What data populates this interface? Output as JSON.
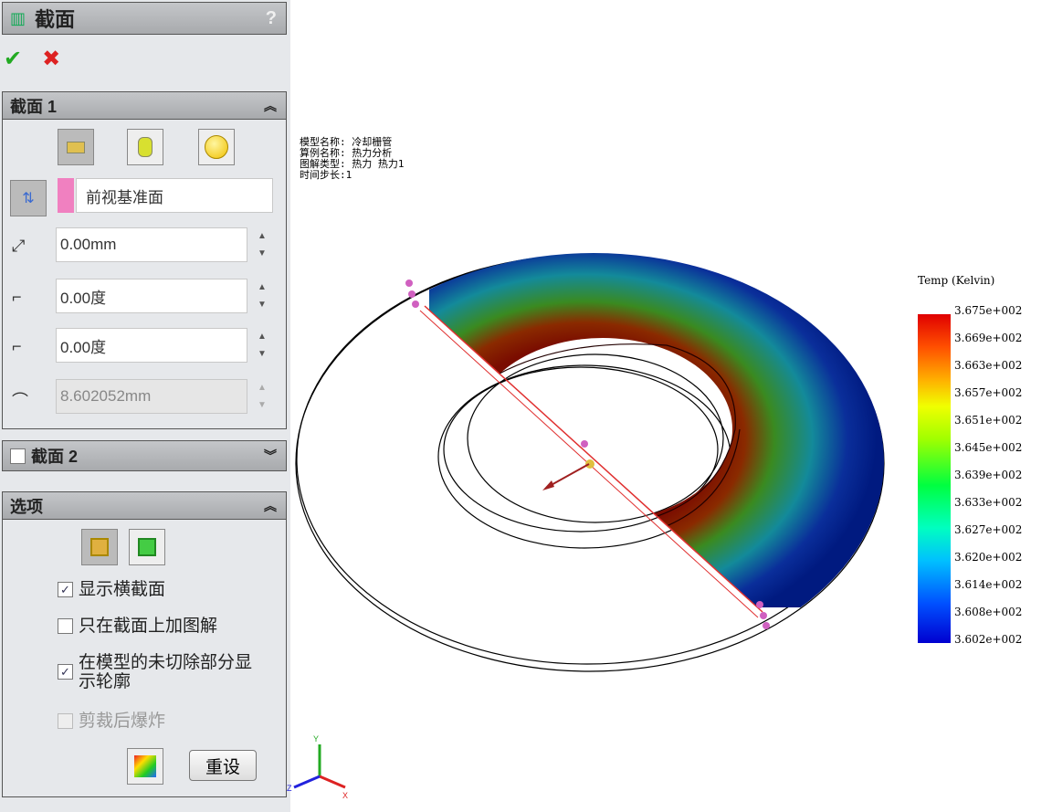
{
  "panel": {
    "title": "截面",
    "help": "?",
    "ok": "✔",
    "cancel": "✖",
    "section1": {
      "title": "截面 1",
      "plane": "前视基准面",
      "offset": "0.00mm",
      "rot_x": "0.00度",
      "rot_y": "0.00度",
      "distance": "8.602052mm"
    },
    "section2": {
      "title": "截面 2"
    },
    "options": {
      "title": "选项",
      "show_cross_section": "显示横截面",
      "plot_on_section_only": "只在截面上加图解",
      "show_outline_line1": "在模型的未切除部分显",
      "show_outline_line2": "示轮廓",
      "explode_after_clip": "剪裁后爆炸",
      "reset": "重设"
    }
  },
  "info": [
    "模型名称: 冷却栅管",
    "算例名称: 热力分析",
    "图解类型: 热力 热力1",
    "时间步长:1"
  ],
  "legend": {
    "title": "Temp (Kelvin)",
    "labels": [
      "3.675e+002",
      "3.669e+002",
      "3.663e+002",
      "3.657e+002",
      "3.651e+002",
      "3.645e+002",
      "3.639e+002",
      "3.633e+002",
      "3.627e+002",
      "3.620e+002",
      "3.614e+002",
      "3.608e+002",
      "3.602e+002"
    ]
  },
  "triad": {
    "x": "X",
    "y": "Y",
    "z": "Z"
  }
}
